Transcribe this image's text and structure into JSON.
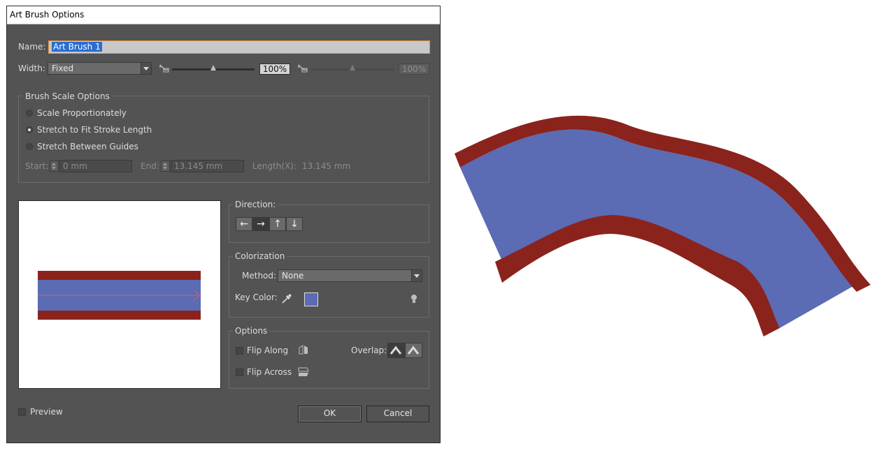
{
  "window": {
    "title": "Art Brush Options"
  },
  "name_field": {
    "label": "Name:",
    "value": "Art Brush 1"
  },
  "width": {
    "label": "Width:",
    "mode": "Fixed",
    "percent_left": "100%",
    "percent_right": "100%",
    "slider_left_level": 0.5,
    "slider_right_level": 0.5
  },
  "brush_scale": {
    "title": "Brush Scale Options",
    "options": [
      "Scale Proportionately",
      "Stretch to Fit Stroke Length",
      "Stretch Between Guides"
    ],
    "selected_index": 1,
    "start_label": "Start:",
    "start_value": "0 mm",
    "end_label": "End:",
    "end_value": "13.145 mm",
    "length_label": "Length(X):",
    "length_value": "13.145 mm"
  },
  "direction": {
    "title": "Direction:",
    "buttons": [
      "←",
      "→",
      "↑",
      "↓"
    ],
    "selected_index": 1
  },
  "colorization": {
    "title": "Colorization",
    "method_label": "Method:",
    "method_value": "None",
    "key_color_label": "Key Color:",
    "key_color": "#5b6bb4"
  },
  "options": {
    "title": "Options",
    "flip_along": "Flip Along",
    "flip_across": "Flip Across",
    "overlap_label": "Overlap:"
  },
  "footer": {
    "preview_label": "Preview",
    "ok_label": "OK",
    "cancel_label": "Cancel"
  },
  "colors": {
    "dialog_bg": "#535353",
    "brush_red": "#8b231d",
    "brush_blue": "#5b6bb4",
    "arrow": "#d0606a"
  },
  "icons": [
    "width-point-icon",
    "eyedropper-icon",
    "lightbulb-icon",
    "flip-along-icon",
    "flip-across-icon",
    "overlap-icon"
  ]
}
